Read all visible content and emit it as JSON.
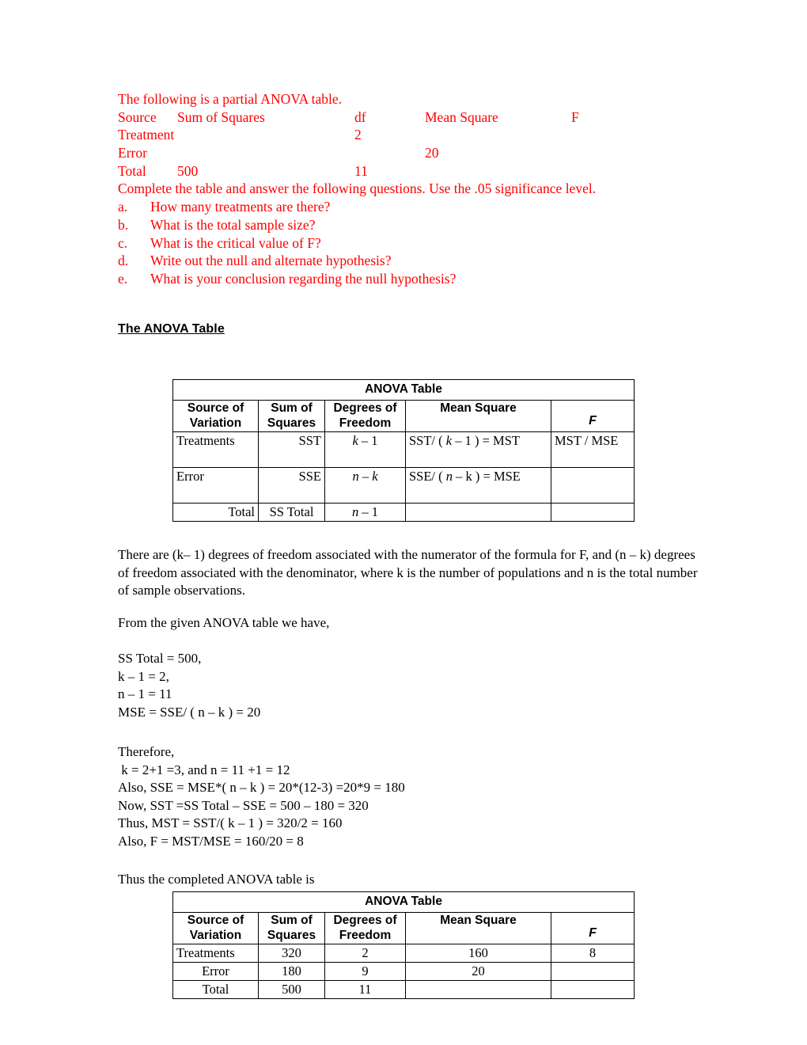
{
  "problem": {
    "intro": "The following is a partial ANOVA table.",
    "partial_table": {
      "header": {
        "source": "Source",
        "sum_of_squares": "Sum of Squares",
        "df": "df",
        "mean_square": "Mean Square",
        "f": "F"
      },
      "rows": [
        {
          "source": "Treatment",
          "sum_of_squares": "",
          "df": "2",
          "mean_square": "",
          "f": ""
        },
        {
          "source": "Error",
          "sum_of_squares": "",
          "df": "",
          "mean_square": "20",
          "f": ""
        },
        {
          "source": "Total",
          "sum_of_squares": "500",
          "df": "11",
          "mean_square": "",
          "f": ""
        }
      ]
    },
    "instruction": "Complete the table and answer the following questions. Use the .05 significance level.",
    "questions": [
      {
        "marker": "a.",
        "text": "How many treatments are there?"
      },
      {
        "marker": "b.",
        "text": "What is the total sample size?"
      },
      {
        "marker": "c.",
        "text": "What is the critical value of F?"
      },
      {
        "marker": "d.",
        "text": "Write out the null and alternate hypothesis?"
      },
      {
        "marker": "e.",
        "text": "What is your conclusion regarding the null hypothesis?"
      }
    ],
    "color": "#ff0000"
  },
  "section_heading": "The ANOVA Table",
  "table_generic": {
    "title": "ANOVA Table",
    "headers": {
      "source": "Source of Variation",
      "source_l1": "Source of",
      "source_l2": "Variation",
      "ss": "Sum of Squares",
      "ss_l1": "Sum of",
      "ss_l2": "Squares",
      "df": "Degrees of Freedom",
      "df_l1": "Degrees of",
      "df_l2": "Freedom",
      "ms": "Mean Square",
      "f": "F"
    },
    "rows": [
      {
        "source": "Treatments",
        "ss": "SST",
        "df_a": "k",
        "df_op": " – 1",
        "ms_pre": "SST/ ( ",
        "ms_var": "k",
        "ms_post": " – 1 ) = MST",
        "f": "MST / MSE"
      },
      {
        "source": "Error",
        "ss": "SSE",
        "df_a": "n",
        "df_op": " –  k",
        "ms_pre": "SSE/ ( ",
        "ms_var": "n",
        "ms_post": " – k ) = MSE",
        "f": ""
      },
      {
        "source": "Total",
        "ss": "SS Total",
        "df_a": "n",
        "df_op": " –  1",
        "ms_pre": "",
        "ms_var": "",
        "ms_post": "",
        "f": ""
      }
    ]
  },
  "explanation": {
    "df_paragraph": "There are (k– 1) degrees of freedom associated with the numerator of the formula for F, and (n – k) degrees of freedom associated with the denominator, where k is the number of populations and n is the total number of sample observations.",
    "given_intro": "From the given ANOVA table we have,",
    "given_lines": [
      "SS Total = 500,",
      "k – 1 = 2,",
      "n – 1 = 11",
      "MSE = SSE/ ( n – k ) = 20"
    ],
    "therefore_label": "Therefore,",
    "therefore_lines": [
      " k = 2+1 =3, and n = 11 +1 = 12",
      "Also, SSE = MSE*( n – k ) = 20*(12-3) =20*9 = 180",
      "Now, SST =SS Total – SSE = 500 – 180 = 320",
      "Thus, MST = SST/( k – 1 ) = 320/2 = 160",
      "Also, F = MST/MSE = 160/20 = 8"
    ],
    "completed_intro": "Thus the completed ANOVA table is"
  },
  "table_completed": {
    "title": "ANOVA Table",
    "headers": {
      "source_l1": "Source of",
      "source_l2": "Variation",
      "ss_l1": "Sum of",
      "ss_l2": "Squares",
      "df_l1": "Degrees of",
      "df_l2": "Freedom",
      "ms": "Mean Square",
      "f": "F"
    },
    "rows": [
      {
        "source": "Treatments",
        "ss": "320",
        "df": "2",
        "ms": "160",
        "f": "8"
      },
      {
        "source": "Error",
        "ss": "180",
        "df": "9",
        "ms": "20",
        "f": ""
      },
      {
        "source": "Total",
        "ss": "500",
        "df": "11",
        "ms": "",
        "f": ""
      }
    ]
  }
}
